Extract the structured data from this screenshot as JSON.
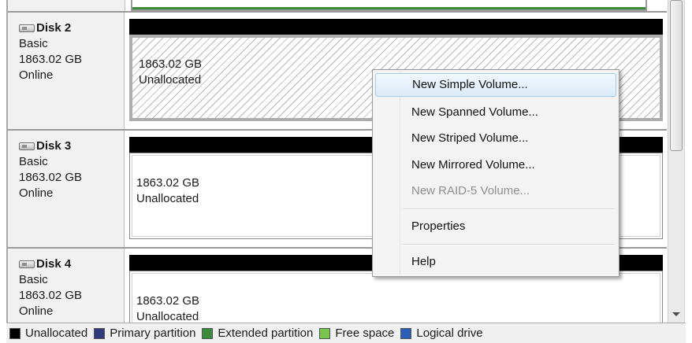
{
  "disks": [
    {
      "name": "Disk 2",
      "type": "Basic",
      "size": "1863.02 GB",
      "status": "Online",
      "volume": {
        "size": "1863.02 GB",
        "state": "Unallocated"
      }
    },
    {
      "name": "Disk 3",
      "type": "Basic",
      "size": "1863.02 GB",
      "status": "Online",
      "volume": {
        "size": "1863.02 GB",
        "state": "Unallocated"
      }
    },
    {
      "name": "Disk 4",
      "type": "Basic",
      "size": "1863.02 GB",
      "status": "Online",
      "volume": {
        "size": "1863.02 GB",
        "state": "Unallocated"
      }
    }
  ],
  "context_menu": {
    "items": [
      {
        "label": "New Simple Volume...",
        "state": "hover"
      },
      {
        "label": "New Spanned Volume...",
        "state": "enabled"
      },
      {
        "label": "New Striped Volume...",
        "state": "enabled"
      },
      {
        "label": "New Mirrored Volume...",
        "state": "enabled"
      },
      {
        "label": "New RAID-5 Volume...",
        "state": "disabled"
      },
      {
        "label": "Properties",
        "state": "enabled"
      },
      {
        "label": "Help",
        "state": "enabled"
      }
    ]
  },
  "legend": {
    "items": [
      {
        "label": "Unallocated",
        "color": "#000000"
      },
      {
        "label": "Primary partition",
        "color": "#2f3a7a"
      },
      {
        "label": "Extended partition",
        "color": "#3a8a3a"
      },
      {
        "label": "Free space",
        "color": "#78c450"
      },
      {
        "label": "Logical drive",
        "color": "#2a5fb8"
      }
    ]
  },
  "colors": {
    "extended_partition_line": "#3a8a3a",
    "menu_hover": "#dbeaf8"
  }
}
